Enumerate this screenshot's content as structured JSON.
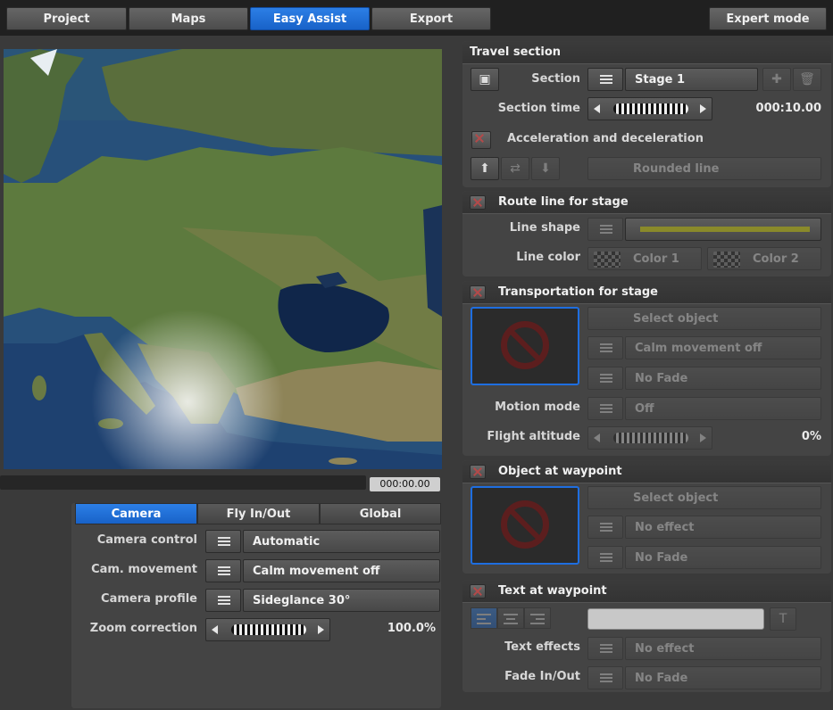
{
  "tabs": [
    "Project",
    "Maps",
    "Easy Assist",
    "Export"
  ],
  "expert_mode": "Expert mode",
  "timecode": "000:00.00",
  "camera_panel": {
    "tabs": [
      "Camera",
      "Fly In/Out",
      "Global"
    ],
    "camera_control": {
      "label": "Camera control",
      "value": "Automatic"
    },
    "cam_movement": {
      "label": "Cam. movement",
      "value": "Calm movement off"
    },
    "camera_profile": {
      "label": "Camera profile",
      "value": "Sideglance 30°"
    },
    "zoom_correction": {
      "label": "Zoom correction",
      "value": "100.0%"
    }
  },
  "travel_section": {
    "title": "Travel section",
    "section_label": "Section",
    "section_value": "Stage 1",
    "section_time_label": "Section time",
    "section_time_value": "000:10.00",
    "accel_label": "Acceleration and deceleration",
    "rounded_line": "Rounded line"
  },
  "route_line": {
    "title": "Route line for stage",
    "line_shape_label": "Line shape",
    "line_shape_color": "#9a9a2a",
    "line_color_label": "Line color",
    "color1": "Color 1",
    "color2": "Color 2"
  },
  "transportation": {
    "title": "Transportation for stage",
    "select_object": "Select object",
    "calm_movement": "Calm movement off",
    "no_fade": "No Fade",
    "motion_mode_label": "Motion mode",
    "motion_mode_value": "Off",
    "flight_altitude_label": "Flight altitude",
    "flight_altitude_value": "0%"
  },
  "object_waypoint": {
    "title": "Object at waypoint",
    "select_object": "Select object",
    "no_effect": "No effect",
    "no_fade": "No Fade"
  },
  "text_waypoint": {
    "title": "Text at waypoint",
    "text_effects_label": "Text effects",
    "text_effects_value": "No effect",
    "fade_label": "Fade In/Out",
    "fade_value": "No Fade"
  },
  "colors": {
    "accent": "#1e6ee0",
    "panel": "#444444",
    "background": "#3a3a3a"
  }
}
